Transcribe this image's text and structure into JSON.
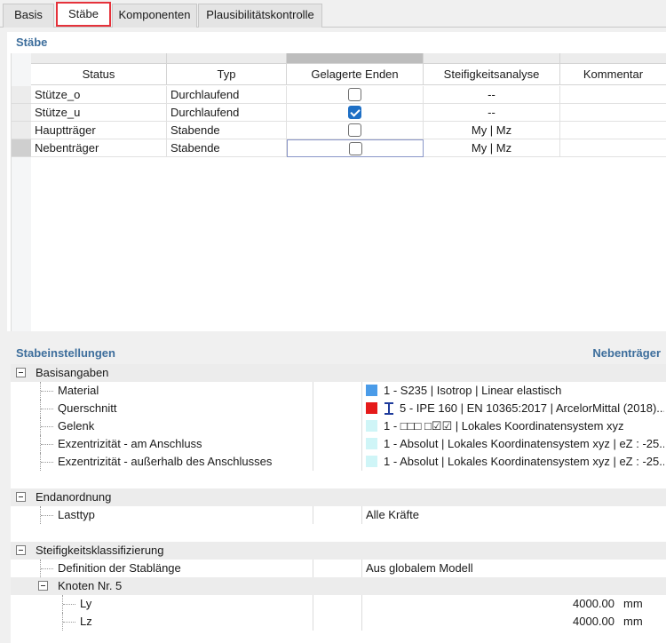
{
  "tabs": [
    "Basis",
    "Stäbe",
    "Komponenten",
    "Plausibilitätskontrolle"
  ],
  "members_panel": {
    "title": "Stäbe",
    "columns": [
      "Status",
      "Typ",
      "Gelagerte Enden",
      "Steifigkeitsanalyse",
      "Kommentar"
    ],
    "rows": [
      {
        "status": "Stütze_o",
        "typ": "Durchlaufend",
        "checked": false,
        "analysis": "--",
        "comment": ""
      },
      {
        "status": "Stütze_u",
        "typ": "Durchlaufend",
        "checked": true,
        "analysis": "--",
        "comment": ""
      },
      {
        "status": "Hauptträger",
        "typ": "Stabende",
        "checked": false,
        "analysis": "My | Mz",
        "comment": ""
      },
      {
        "status": "Nebenträger",
        "typ": "Stabende",
        "checked": false,
        "analysis": "My | Mz",
        "comment": ""
      }
    ]
  },
  "settings_panel": {
    "title": "Stabeinstellungen",
    "selected_member": "Nebenträger",
    "groups": {
      "basis": {
        "label": "Basisangaben",
        "material_label": "Material",
        "material_value": "1 - S235 | Isotrop | Linear elastisch",
        "material_color": "#4a9be8",
        "cross_label": "Querschnitt",
        "cross_value": "5 - IPE 160 | EN 10365:2017 | ArcelorMittal (2018)...",
        "cross_color": "#e51a1a",
        "hinge_label": "Gelenk",
        "hinge_value": "1 - □□□ □☑☑ | Lokales Koordinatensystem xyz",
        "ecc1_label": "Exzentrizität - am Anschluss",
        "ecc1_value": "1 - Absolut | Lokales Koordinatensystem xyz | eZ : -25...",
        "ecc2_label": "Exzentrizität - außerhalb des Anschlusses",
        "ecc2_value": "1 - Absolut | Lokales Koordinatensystem xyz | eZ : -25...",
        "light_color": "#cff5f7"
      },
      "end": {
        "label": "Endanordnung",
        "load_label": "Lasttyp",
        "load_value": "Alle Kräfte"
      },
      "stiff": {
        "label": "Steifigkeitsklassifizierung",
        "def_label": "Definition der Stablänge",
        "def_value": "Aus globalem Modell",
        "node_label": "Knoten Nr. 5",
        "ly_label": "Ly",
        "ly_value": "4000.00",
        "lz_label": "Lz",
        "lz_value": "4000.00",
        "unit": "mm"
      }
    }
  }
}
